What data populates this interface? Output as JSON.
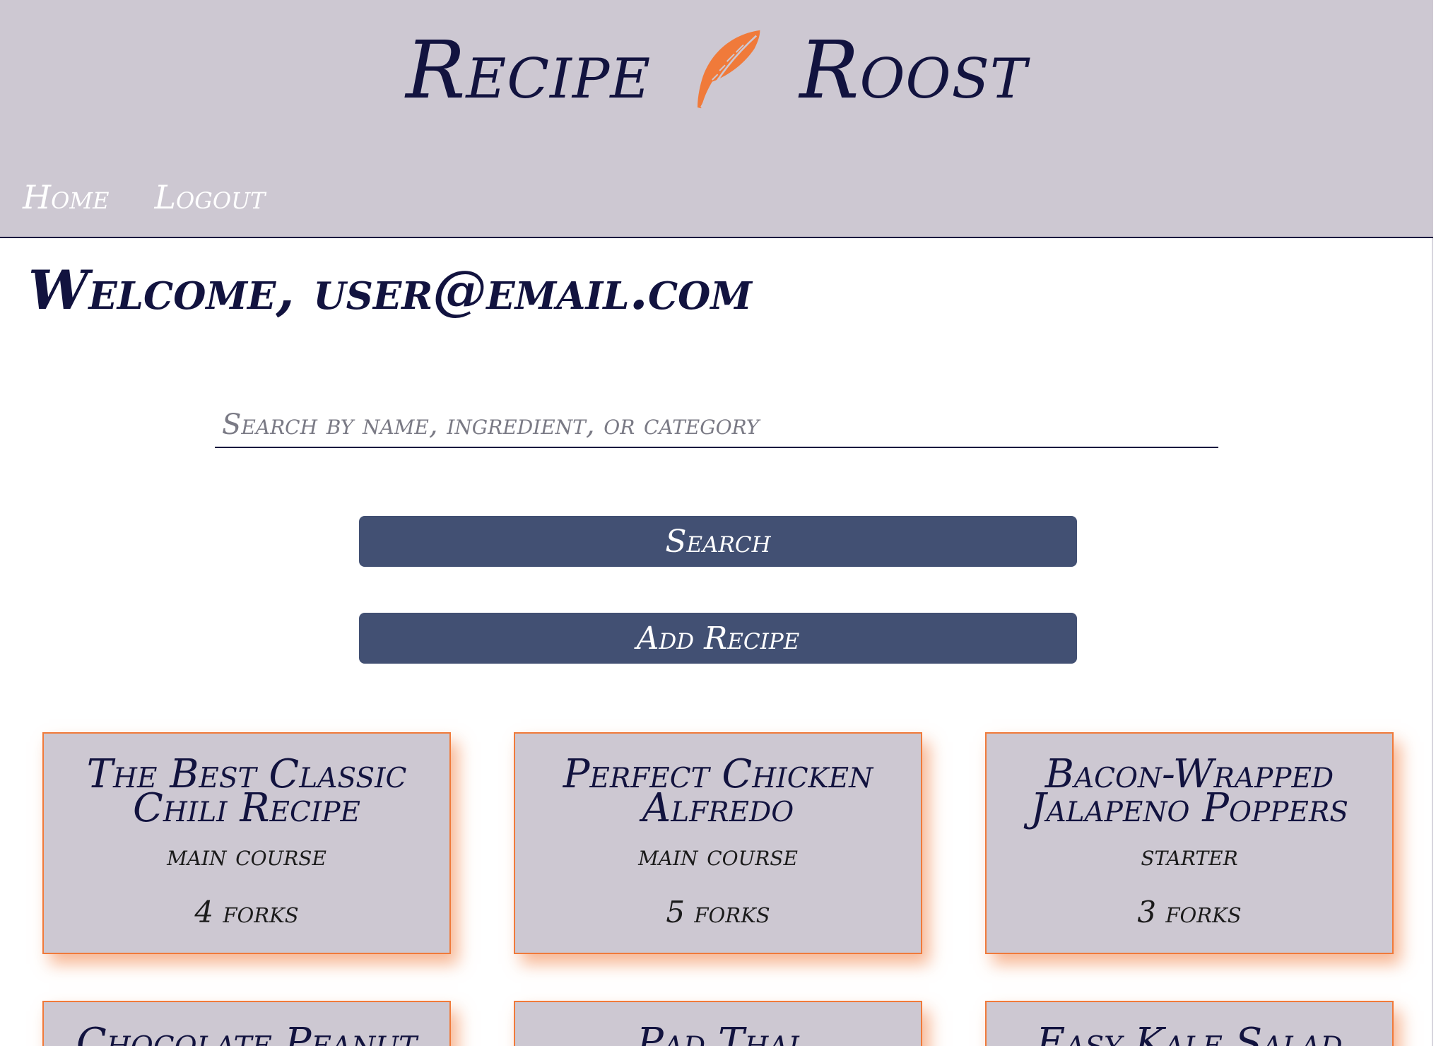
{
  "header": {
    "brand_left": "Recipe",
    "brand_right": "Roost",
    "brand_icon": "feather-icon",
    "nav": [
      {
        "label": "Home"
      },
      {
        "label": "Logout"
      }
    ]
  },
  "main": {
    "welcome_text": "Welcome, user@email.com",
    "search": {
      "placeholder": "Search by name, ingredient, or category",
      "value": ""
    },
    "search_button_label": "Search",
    "add_recipe_button_label": "Add Recipe",
    "recipes": [
      {
        "title": "The Best Classic Chili Recipe",
        "category": "main course",
        "rating": "4 forks"
      },
      {
        "title": "Perfect Chicken Alfredo",
        "category": "main course",
        "rating": "5 forks"
      },
      {
        "title": "Bacon-Wrapped Jalapeno Poppers",
        "category": "starter",
        "rating": "3 forks"
      },
      {
        "title": "Chocolate Peanut",
        "category": "",
        "rating": ""
      },
      {
        "title": "Pad Thai",
        "category": "",
        "rating": ""
      },
      {
        "title": "Easy Kale Salad with",
        "category": "",
        "rating": ""
      }
    ]
  },
  "colors": {
    "header_bg": "#cdc8d2",
    "primary_text": "#12133f",
    "button_bg": "#425073",
    "accent": "#f07a3a"
  }
}
